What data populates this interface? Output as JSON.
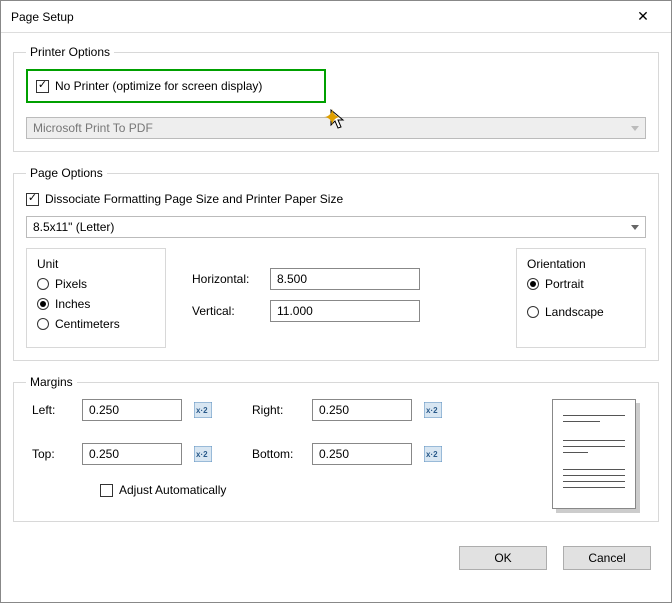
{
  "window": {
    "title": "Page Setup"
  },
  "printerOptions": {
    "legend": "Printer Options",
    "noPrinterLabel": "No Printer (optimize for screen display)",
    "noPrinterChecked": true,
    "printerName": "Microsoft Print To PDF"
  },
  "pageOptions": {
    "legend": "Page Options",
    "dissociateLabel": "Dissociate Formatting Page Size and Printer Paper Size",
    "dissociateChecked": true,
    "pageSize": "8.5x11\" (Letter)",
    "unit": {
      "title": "Unit",
      "options": {
        "pixels": "Pixels",
        "inches": "Inches",
        "centimeters": "Centimeters"
      },
      "selected": "inches"
    },
    "horizontalLabel": "Horizontal:",
    "horizontalValue": "8.500",
    "verticalLabel": "Vertical:",
    "verticalValue": "11.000",
    "orientation": {
      "title": "Orientation",
      "portrait": "Portrait",
      "landscape": "Landscape",
      "selected": "portrait"
    }
  },
  "margins": {
    "legend": "Margins",
    "leftLabel": "Left:",
    "leftValue": "0.250",
    "rightLabel": "Right:",
    "rightValue": "0.250",
    "topLabel": "Top:",
    "topValue": "0.250",
    "bottomLabel": "Bottom:",
    "bottomValue": "0.250",
    "adjustLabel": "Adjust Automatically",
    "adjustChecked": false
  },
  "buttons": {
    "ok": "OK",
    "cancel": "Cancel"
  }
}
